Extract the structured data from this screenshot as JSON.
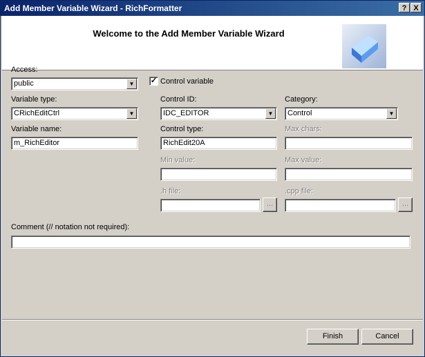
{
  "window": {
    "title": "Add Member Variable Wizard - RichFormatter",
    "help_glyph": "?",
    "close_glyph": "X"
  },
  "header": {
    "title": "Welcome to the Add Member Variable Wizard",
    "icon": "wizard-cube-icon"
  },
  "form": {
    "access": {
      "label": "Access:",
      "value": "public"
    },
    "control_variable": {
      "label": "Control variable",
      "checked": true,
      "glyph": "✓"
    },
    "variable_type": {
      "label": "Variable type:",
      "value": "CRichEditCtrl"
    },
    "control_id": {
      "label": "Control ID:",
      "value": "IDC_EDITOR"
    },
    "category": {
      "label": "Category:",
      "value": "Control"
    },
    "variable_name": {
      "label": "Variable name:",
      "value": "m_RichEditor"
    },
    "control_type": {
      "label": "Control type:",
      "value": "RichEdit20A"
    },
    "max_chars": {
      "label": "Max chars:",
      "value": ""
    },
    "min_value": {
      "label": "Min value:",
      "value": ""
    },
    "max_value": {
      "label": "Max value:",
      "value": ""
    },
    "h_file": {
      "label": ".h file:",
      "value": "",
      "browse": "..."
    },
    "cpp_file": {
      "label": ".cpp file:",
      "value": "",
      "browse": "..."
    },
    "comment": {
      "label": "Comment (// notation not required):",
      "value": ""
    }
  },
  "buttons": {
    "finish": "Finish",
    "cancel": "Cancel"
  },
  "icons": {
    "dropdown": "▼"
  },
  "colors": {
    "titlebar": "#0a246a",
    "face": "#d4d0c8",
    "disabled_text": "#808080"
  }
}
